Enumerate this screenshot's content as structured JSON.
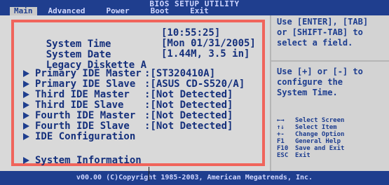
{
  "title": "BIOS SETUP UTILITY",
  "tabs": [
    "Main",
    "Advanced",
    "Power",
    "Boot",
    "Exit"
  ],
  "main": {
    "system_time_label": "System Time",
    "system_time_value": "[10:55:25]",
    "system_date_label": "System Date",
    "system_date_value": "[Mon 01/31/2005]",
    "legacy_label": "Legacy Diskette A",
    "legacy_value": "[1.44M, 3.5 in]",
    "ide": [
      {
        "label": "Primary IDE Master",
        "value": ":[ST320410A]"
      },
      {
        "label": "Primary IDE Slave",
        "value": ":[ASUS CD-S520/A]"
      },
      {
        "label": "Third IDE Master",
        "value": ":[Not Detected]"
      },
      {
        "label": "Third IDE Slave",
        "value": ":[Not Detected]"
      },
      {
        "label": "Fourth IDE Master",
        "value": ":[Not Detected]"
      },
      {
        "label": "Fourth IDE Slave",
        "value": ":[Not Detected]"
      }
    ],
    "ide_config": "IDE Configuration",
    "system_info": "System Information"
  },
  "help": {
    "line1": "Use [ENTER], [TAB]",
    "line2": "or [SHIFT-TAB] to",
    "line3": "select a field.",
    "line4": "Use [+] or [-] to",
    "line5": "configure the",
    "line6": "System Time."
  },
  "keys": [
    {
      "key": "←→",
      "desc": "Select Screen"
    },
    {
      "key": "↑↓",
      "desc": "Select Item"
    },
    {
      "key": "+-",
      "desc": "Change Option"
    },
    {
      "key": "F1",
      "desc": "General Help"
    },
    {
      "key": "F10",
      "desc": "Save and Exit"
    },
    {
      "key": "ESC",
      "desc": "Exit"
    }
  ],
  "footer": "v00.00 (C)Copyright 1985-2003, American Megatrends, Inc."
}
